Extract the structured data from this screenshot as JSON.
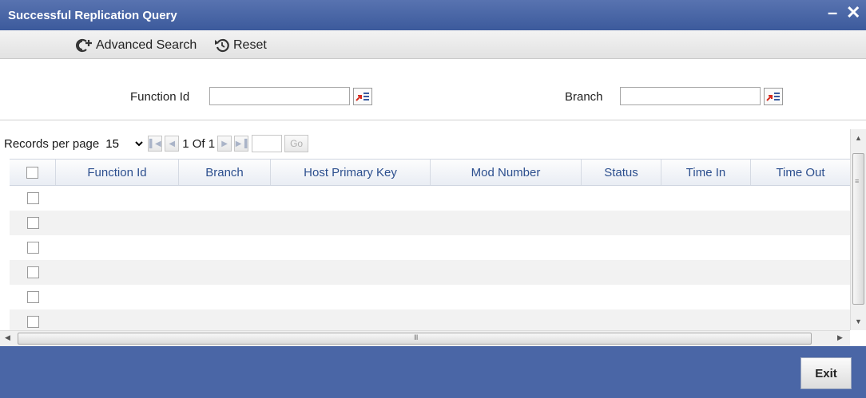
{
  "window": {
    "title": "Successful Replication Query",
    "minimize_glyph": "–",
    "close_glyph": "✕"
  },
  "toolbar": {
    "advanced_search_label": "Advanced Search",
    "reset_label": "Reset"
  },
  "search": {
    "fields": [
      {
        "label": "Function Id",
        "value": ""
      },
      {
        "label": "Branch",
        "value": ""
      }
    ]
  },
  "pager": {
    "records_per_page_label": "Records per page",
    "records_per_page": "15",
    "page_text": "1 Of 1",
    "go_label": "Go"
  },
  "grid": {
    "columns": [
      "Function Id",
      "Branch",
      "Host Primary Key",
      "Mod Number",
      "Status",
      "Time In",
      "Time Out"
    ],
    "row_count": 6
  },
  "hscroll": {
    "grip": "III"
  },
  "footer": {
    "exit_label": "Exit"
  },
  "colors": {
    "title_bar": "#3c5a9c",
    "footer": "#4a66a6",
    "header_text": "#2c4f8e",
    "lov_red": "#d62b1f"
  }
}
